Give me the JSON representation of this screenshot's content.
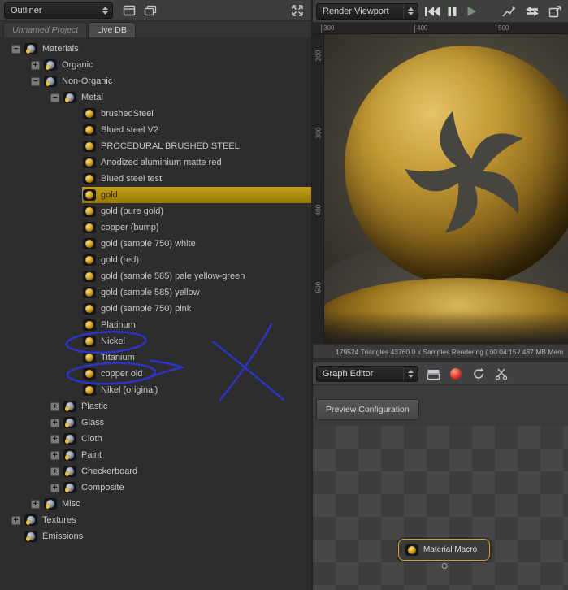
{
  "left_panel": {
    "outliner_label": "Outliner",
    "tabs": [
      {
        "label": "Unnamed Project",
        "active": false
      },
      {
        "label": "Live DB",
        "active": true
      }
    ],
    "tree": [
      {
        "label": "Materials",
        "depth": 0,
        "kind": "cat",
        "toggle": "minus",
        "selected": false
      },
      {
        "label": "Organic",
        "depth": 1,
        "kind": "cat",
        "toggle": "plus",
        "selected": false
      },
      {
        "label": "Non-Organic",
        "depth": 1,
        "kind": "cat",
        "toggle": "minus",
        "selected": false
      },
      {
        "label": "Metal",
        "depth": 2,
        "kind": "cat",
        "toggle": "minus",
        "selected": false
      },
      {
        "label": "brushedSteel",
        "depth": 3,
        "kind": "mat",
        "toggle": "none",
        "selected": false
      },
      {
        "label": "Blued steel V2",
        "depth": 3,
        "kind": "mat",
        "toggle": "none",
        "selected": false
      },
      {
        "label": "PROCEDURAL BRUSHED STEEL",
        "depth": 3,
        "kind": "mat",
        "toggle": "none",
        "selected": false
      },
      {
        "label": "Anodized aluminium matte red",
        "depth": 3,
        "kind": "mat",
        "toggle": "none",
        "selected": false
      },
      {
        "label": "Blued steel test",
        "depth": 3,
        "kind": "mat",
        "toggle": "none",
        "selected": false
      },
      {
        "label": "gold",
        "depth": 3,
        "kind": "mat",
        "toggle": "none",
        "selected": true
      },
      {
        "label": "gold (pure gold)",
        "depth": 3,
        "kind": "mat",
        "toggle": "none",
        "selected": false
      },
      {
        "label": "copper (bump)",
        "depth": 3,
        "kind": "mat",
        "toggle": "none",
        "selected": false
      },
      {
        "label": "gold (sample 750) white",
        "depth": 3,
        "kind": "mat",
        "toggle": "none",
        "selected": false
      },
      {
        "label": "gold (red)",
        "depth": 3,
        "kind": "mat",
        "toggle": "none",
        "selected": false
      },
      {
        "label": "gold (sample 585) pale yellow-green",
        "depth": 3,
        "kind": "mat",
        "toggle": "none",
        "selected": false
      },
      {
        "label": "gold (sample 585) yellow",
        "depth": 3,
        "kind": "mat",
        "toggle": "none",
        "selected": false
      },
      {
        "label": "gold (sample 750) pink",
        "depth": 3,
        "kind": "mat",
        "toggle": "none",
        "selected": false
      },
      {
        "label": "Platinum",
        "depth": 3,
        "kind": "mat",
        "toggle": "none",
        "selected": false
      },
      {
        "label": "Nickel",
        "depth": 3,
        "kind": "mat",
        "toggle": "none",
        "selected": false
      },
      {
        "label": "Titanium",
        "depth": 3,
        "kind": "mat",
        "toggle": "none",
        "selected": false
      },
      {
        "label": "copper old",
        "depth": 3,
        "kind": "mat",
        "toggle": "none",
        "selected": false
      },
      {
        "label": "Nikel (original)",
        "depth": 3,
        "kind": "mat",
        "toggle": "none",
        "selected": false
      },
      {
        "label": "Plastic",
        "depth": 2,
        "kind": "cat",
        "toggle": "plus",
        "selected": false
      },
      {
        "label": "Glass",
        "depth": 2,
        "kind": "cat",
        "toggle": "plus",
        "selected": false
      },
      {
        "label": "Cloth",
        "depth": 2,
        "kind": "cat",
        "toggle": "plus",
        "selected": false
      },
      {
        "label": "Paint",
        "depth": 2,
        "kind": "cat",
        "toggle": "plus",
        "selected": false
      },
      {
        "label": "Checkerboard",
        "depth": 2,
        "kind": "cat",
        "toggle": "plus",
        "selected": false
      },
      {
        "label": "Composite",
        "depth": 2,
        "kind": "cat",
        "toggle": "plus",
        "selected": false
      },
      {
        "label": "Misc",
        "depth": 1,
        "kind": "cat",
        "toggle": "plus",
        "selected": false
      },
      {
        "label": "Textures",
        "depth": 0,
        "kind": "cat",
        "toggle": "plus",
        "selected": false
      },
      {
        "label": "Emissions",
        "depth": 0,
        "kind": "cat",
        "toggle": "none",
        "selected": false
      }
    ]
  },
  "viewport": {
    "selector_label": "Render Viewport",
    "ruler_top": [
      {
        "label": "300",
        "pos": 10
      },
      {
        "label": "400",
        "pos": 125
      },
      {
        "label": "500",
        "pos": 225
      }
    ],
    "ruler_left": [
      {
        "label": "200",
        "pos": 22
      },
      {
        "label": "300",
        "pos": 117
      },
      {
        "label": "400",
        "pos": 212
      },
      {
        "label": "500",
        "pos": 307
      }
    ],
    "status": "179524 Triangles   43760.0 k Samples   Rendering ( 00:04:15 / 487 MB Mem"
  },
  "graph_editor": {
    "selector_label": "Graph Editor",
    "preview_button_label": "Preview Configuration",
    "node_label": "Material Macro"
  },
  "colors": {
    "selection_gold": "#b8960c",
    "node_border_gold": "#c9a13b",
    "annotation_blue": "#2b35d8",
    "panel_dark": "#2d2d2d",
    "panel_mid": "#3b3b3b"
  },
  "icons": [
    "combo-arrows-icon",
    "panel-icon",
    "duplicate-panel-icon",
    "expand-panel-icon",
    "skip-back-icon",
    "pause-icon",
    "play-icon",
    "tone-curve-icon",
    "swap-arrows-icon",
    "pop-out-icon",
    "new-window-icon",
    "red-material-icon",
    "refresh-icon",
    "snippet-icon",
    "material-ball-icon",
    "category-icon",
    "node-port"
  ]
}
